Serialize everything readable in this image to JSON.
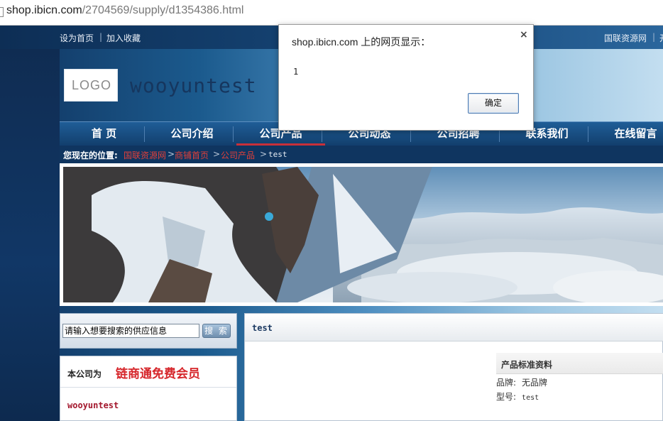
{
  "browser": {
    "url_host": "shop.ibicn.com",
    "url_path": "/2704569/supply/d1354386.html"
  },
  "topbar": {
    "set_home": "设为首页",
    "separator": "|",
    "add_favorite": "加入收藏",
    "right_link": "国联资源网",
    "right_sep": "|",
    "right_more": "开"
  },
  "header": {
    "logo_text": "LOGO",
    "company_name": "wooyuntest"
  },
  "nav": {
    "items": [
      "首 页",
      "公司介绍",
      "公司产品",
      "公司动态",
      "公司招聘",
      "联系我们",
      "在线留言"
    ],
    "active_index": 2,
    "active_color": "#c8303a"
  },
  "breadcrumb": {
    "label": "您现在的位置:",
    "links": [
      "国联资源网",
      "商铺首页",
      "公司产品"
    ],
    "arrow": ">",
    "current": "test"
  },
  "search": {
    "input_value": "请输入想要搜索的供应信息",
    "button_label": "搜 索"
  },
  "member": {
    "label": "本公司为",
    "badge": "链商通免费会员",
    "company": "wooyuntest"
  },
  "product": {
    "title": "test",
    "spec_heading": "产品标准资料",
    "brand_label": "品牌:",
    "brand_value": "无品牌",
    "model_label": "型号:",
    "model_value": "test"
  },
  "dialog": {
    "title": "shop.ibicn.com 上的网页显示：",
    "close_icon": "close-icon",
    "close_glyph": "×",
    "message": "1",
    "ok_label": "确定"
  }
}
